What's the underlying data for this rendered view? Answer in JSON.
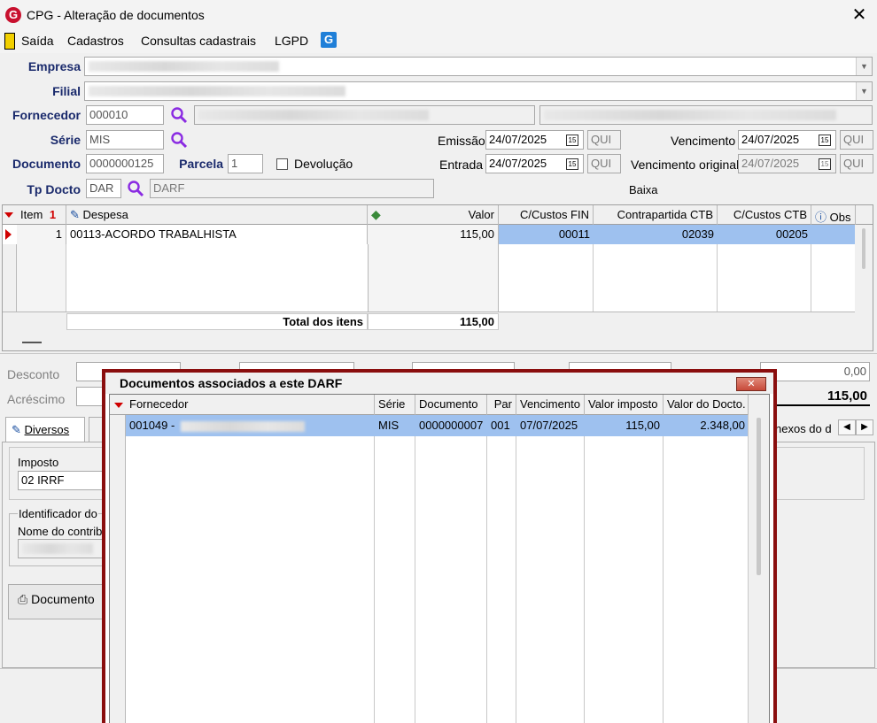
{
  "window": {
    "title": "CPG - Alteração de documentos",
    "close_symbol": "✕"
  },
  "menu": {
    "items": [
      "Saída",
      "Cadastros",
      "Consultas cadastrais",
      "LGPD"
    ]
  },
  "form": {
    "empresa_label": "Empresa",
    "filial_label": "Filial",
    "fornecedor_label": "Fornecedor",
    "fornecedor_code": "000010",
    "serie_label": "Série",
    "serie_value": "MIS",
    "documento_label": "Documento",
    "documento_value": "0000000125",
    "parcela_label": "Parcela",
    "parcela_value": "1",
    "devolucao_label": "Devolução",
    "tp_docto_label": "Tp Docto",
    "tp_docto_code": "DAR",
    "tp_docto_desc": "DARF",
    "emissao_label": "Emissão",
    "emissao_date": "24/07/2025",
    "emissao_day": "QUI",
    "entrada_label": "Entrada",
    "entrada_date": "24/07/2025",
    "entrada_day": "QUI",
    "vencimento_label": "Vencimento",
    "vencimento_date": "24/07/2025",
    "vencimento_day": "QUI",
    "vencimento_original_label": "Vencimento original",
    "vencimento_original_date": "24/07/2025",
    "vencimento_original_day": "QUI",
    "baixa_label": "Baixa",
    "cal_glyph": "15"
  },
  "items_grid": {
    "headers": {
      "item": "Item",
      "item_sort": "1",
      "despesa": "Despesa",
      "valor": "Valor",
      "ccustos_fin": "C/Custos FIN",
      "contrapartida": "Contrapartida CTB",
      "ccustos_ctb": "C/Custos CTB",
      "obs": "Obs"
    },
    "row": {
      "item": "1",
      "despesa": "00113-ACORDO TRABALHISTA",
      "valor": "115,00",
      "ccustos_fin": "00011",
      "contrapartida": "02039",
      "ccustos_ctb": "00205"
    },
    "total_label": "Total dos itens",
    "total_value": "115,00"
  },
  "totals": {
    "desconto_label": "Desconto",
    "acrescimo_label": "Acréscimo",
    "desconto_value": "0,00",
    "total_value": "115,00"
  },
  "tabs": {
    "diversos": "Diversos",
    "anexos": "nexos do d"
  },
  "imposto": {
    "label": "Imposto",
    "value": "02 IRRF",
    "identificador_label": "Identificador do",
    "nome_label": "Nome do contrib"
  },
  "documento_button": "Documento",
  "dialog": {
    "title": "Documentos associados a este DARF",
    "close_symbol": "✕",
    "headers": {
      "fornecedor": "Fornecedor",
      "serie": "Série",
      "documento": "Documento",
      "par": "Par",
      "vencimento": "Vencimento",
      "valor_imposto": "Valor imposto",
      "valor_docto": "Valor do Docto."
    },
    "row": {
      "fornecedor": "001049 -",
      "serie": "MIS",
      "documento": "0000000007",
      "par": "001",
      "vencimento": "07/07/2025",
      "valor_imposto": "115,00",
      "valor_docto": "2.348,00"
    }
  }
}
